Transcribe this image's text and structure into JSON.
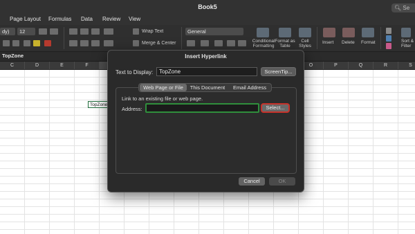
{
  "window": {
    "title": "Book5",
    "search_placeholder": "Se"
  },
  "ribbon_tabs": [
    "Page Layout",
    "Formulas",
    "Data",
    "Review",
    "View"
  ],
  "ribbon": {
    "font_name": "dy)",
    "font_size": "12",
    "wrap_text": "Wrap Text",
    "merge_center": "Merge & Center",
    "number_format": "General",
    "conditional_formatting": "Conditional Formatting",
    "format_as_table": "Format as Table",
    "cell_styles": "Cell Styles",
    "insert": "Insert",
    "delete": "Delete",
    "format": "Format",
    "sort_filter": "Sort & Filter"
  },
  "formula_bar": {
    "name_box": "TopZone"
  },
  "sheet": {
    "columns": [
      "C",
      "D",
      "E",
      "F",
      "G",
      "H",
      "I",
      "J",
      "K",
      "L",
      "M",
      "N",
      "O",
      "P",
      "Q",
      "R",
      "S"
    ],
    "selected_column": "G",
    "active_cell_value": "TopZone"
  },
  "dialog": {
    "title": "Insert Hyperlink",
    "text_to_display_label": "Text to Display:",
    "text_to_display_value": "TopZone",
    "screentip_label": "ScreenTip...",
    "tabs": [
      "Web Page or File",
      "This Document",
      "Email Address"
    ],
    "active_tab": "Web Page or File",
    "link_description": "Link to an existing file or web page.",
    "address_label": "Address:",
    "address_value": "",
    "select_label": "Select...",
    "cancel_label": "Cancel",
    "ok_label": "OK"
  },
  "colors": {
    "address_focus": "#2f8f3c",
    "select_highlight": "#c8322a",
    "window_chrome": "#323232"
  }
}
